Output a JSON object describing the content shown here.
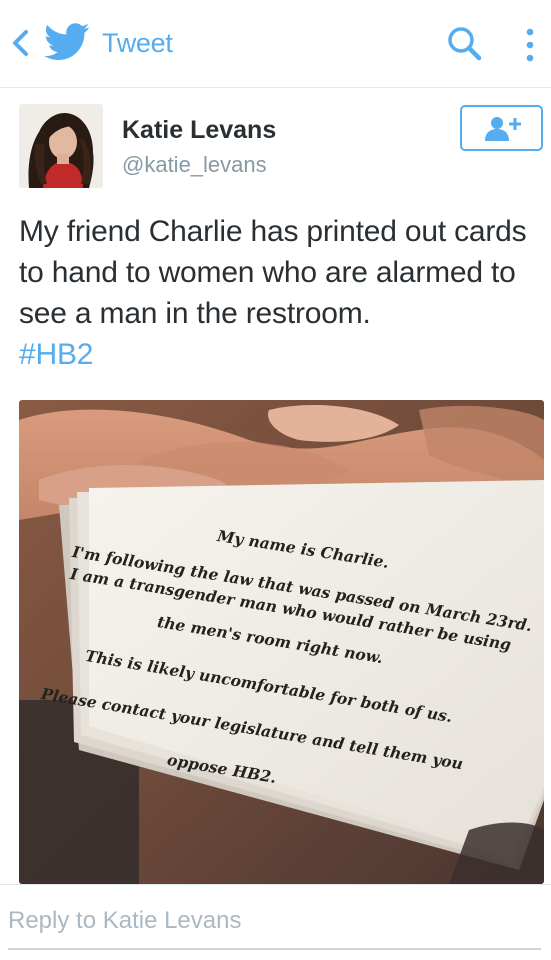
{
  "header": {
    "title": "Tweet",
    "back_icon": "chevron-left-icon",
    "logo_icon": "twitter-bird-icon",
    "search_icon": "search-icon",
    "menu_icon": "more-vertical-icon",
    "accent_color": "#55acee"
  },
  "tweet": {
    "author_name": "Katie Levans",
    "author_handle": "@katie_levans",
    "follow_icon": "add-user-icon",
    "text": "My friend Charlie has printed out cards to hand to women who are alarmed to see a man in the restroom.",
    "hashtag": "#HB2"
  },
  "photo": {
    "card_lines": [
      "My name is Charlie.",
      "I'm following the law that was passed on March 23rd.",
      "I am a transgender man who would rather be using",
      "the men's room right now.",
      "This is likely uncomfortable for both of us.",
      "Please contact your legislature and tell them you",
      "oppose HB2."
    ]
  },
  "reply": {
    "placeholder": "Reply to Katie Levans"
  }
}
